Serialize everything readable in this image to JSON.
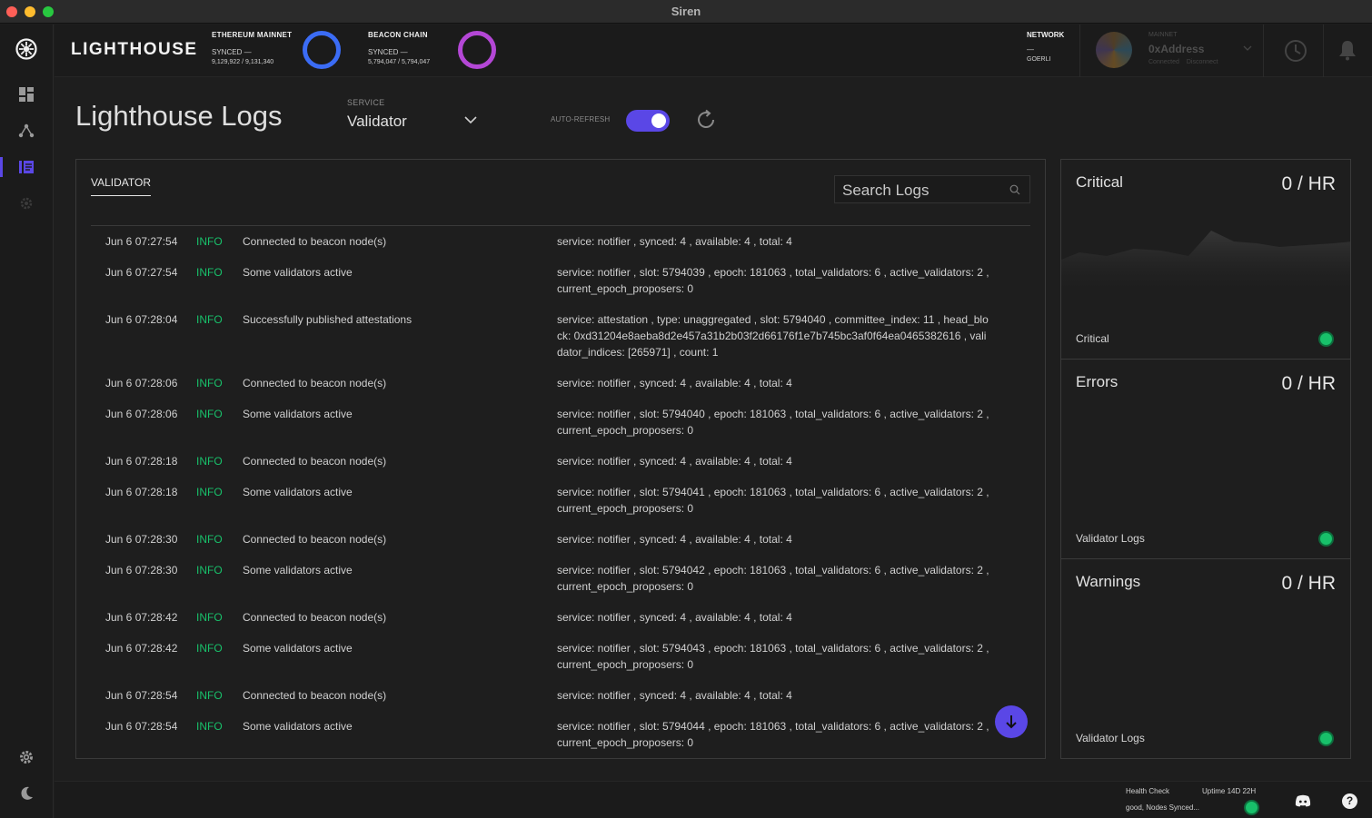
{
  "window": {
    "title": "Siren"
  },
  "header": {
    "brand": "LIGHTHOUSE",
    "ethereum": {
      "title": "ETHEREUM MAINNET",
      "status": "SYNCED —",
      "progress": "9,129,922 / 9,131,340"
    },
    "beacon": {
      "title": "BEACON CHAIN",
      "status": "SYNCED —",
      "progress": "5,794,047 / 5,794,047"
    },
    "network": {
      "title": "NETWORK",
      "dash": "—",
      "value": "GOERLI"
    },
    "account": {
      "network": "MAINNET",
      "address": "0xAddress",
      "connected": "Connected",
      "disconnect": "Disconnect"
    }
  },
  "page": {
    "title": "Lighthouse Logs",
    "service_label": "SERVICE",
    "service_value": "Validator",
    "auto_refresh_label": "AUTO-REFRESH",
    "auto_refresh_on": true
  },
  "logs": {
    "tab": "VALIDATOR",
    "search_placeholder": "Search Logs",
    "rows": [
      {
        "time": "Jun 6 07:27:54",
        "level": "INFO",
        "message": "Connected to beacon node(s)",
        "data": "service: notifier , synced: 4 , available: 4 , total: 4"
      },
      {
        "time": "Jun 6 07:27:54",
        "level": "INFO",
        "message": "Some validators active",
        "data": "service: notifier , slot: 5794039 , epoch: 181063 , total_validators: 6 , active_validators: 2 , current_epoch_proposers: 0"
      },
      {
        "time": "Jun 6 07:28:04",
        "level": "INFO",
        "message": "Successfully published attestations",
        "data": "service: attestation , type: unaggregated , slot: 5794040 , committee_index: 11 , head_block: 0xd31204e8aeba8d2e457a31b2b03f2d66176f1e7b745bc3af0f64ea0465382616 , validator_indices: [265971] , count: 1"
      },
      {
        "time": "Jun 6 07:28:06",
        "level": "INFO",
        "message": "Connected to beacon node(s)",
        "data": "service: notifier , synced: 4 , available: 4 , total: 4"
      },
      {
        "time": "Jun 6 07:28:06",
        "level": "INFO",
        "message": "Some validators active",
        "data": "service: notifier , slot: 5794040 , epoch: 181063 , total_validators: 6 , active_validators: 2 , current_epoch_proposers: 0"
      },
      {
        "time": "Jun 6 07:28:18",
        "level": "INFO",
        "message": "Connected to beacon node(s)",
        "data": "service: notifier , synced: 4 , available: 4 , total: 4"
      },
      {
        "time": "Jun 6 07:28:18",
        "level": "INFO",
        "message": "Some validators active",
        "data": "service: notifier , slot: 5794041 , epoch: 181063 , total_validators: 6 , active_validators: 2 , current_epoch_proposers: 0"
      },
      {
        "time": "Jun 6 07:28:30",
        "level": "INFO",
        "message": "Connected to beacon node(s)",
        "data": "service: notifier , synced: 4 , available: 4 , total: 4"
      },
      {
        "time": "Jun 6 07:28:30",
        "level": "INFO",
        "message": "Some validators active",
        "data": "service: notifier , slot: 5794042 , epoch: 181063 , total_validators: 6 , active_validators: 2 , current_epoch_proposers: 0"
      },
      {
        "time": "Jun 6 07:28:42",
        "level": "INFO",
        "message": "Connected to beacon node(s)",
        "data": "service: notifier , synced: 4 , available: 4 , total: 4"
      },
      {
        "time": "Jun 6 07:28:42",
        "level": "INFO",
        "message": "Some validators active",
        "data": "service: notifier , slot: 5794043 , epoch: 181063 , total_validators: 6 , active_validators: 2 , current_epoch_proposers: 0"
      },
      {
        "time": "Jun 6 07:28:54",
        "level": "INFO",
        "message": "Connected to beacon node(s)",
        "data": "service: notifier , synced: 4 , available: 4 , total: 4"
      },
      {
        "time": "Jun 6 07:28:54",
        "level": "INFO",
        "message": "Some validators active",
        "data": "service: notifier , slot: 5794044 , epoch: 181063 , total_validators: 6 , active_validators: 2 , current_epoch_proposers: 0"
      }
    ]
  },
  "stats": {
    "critical": {
      "title": "Critical",
      "rate": "0 / HR",
      "footer": "Critical"
    },
    "errors": {
      "title": "Errors",
      "rate": "0 / HR",
      "footer": "Validator Logs"
    },
    "warnings": {
      "title": "Warnings",
      "rate": "0 / HR",
      "footer": "Validator Logs"
    }
  },
  "footer": {
    "health_label": "Health Check",
    "health_status": "good, Nodes Synced...",
    "uptime": "Uptime 14D 22H",
    "help": "?"
  },
  "colors": {
    "accent": "#5a47e6",
    "success": "#18c06a",
    "ethereum_ring": "#3b6cf5",
    "beacon_ring": "#b447d6"
  },
  "icons": {
    "sidebar": [
      "lighthouse-logo-icon",
      "dashboard-grid-icon",
      "nodes-network-icon",
      "logs-icon",
      "validators-gear-icon",
      "settings-gear-icon",
      "moon-icon"
    ],
    "header": [
      "history-clock-icon",
      "bell-icon"
    ],
    "footer": [
      "discord-icon",
      "help-icon"
    ]
  }
}
